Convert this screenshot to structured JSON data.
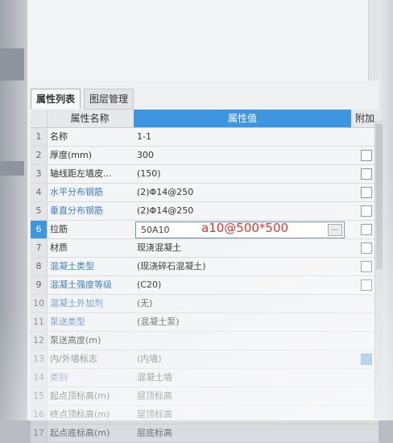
{
  "tabs": [
    {
      "label": "属性列表"
    },
    {
      "label": "图层管理"
    }
  ],
  "headers": {
    "name": "属性名称",
    "value": "属性值",
    "addon": "附加"
  },
  "rows": [
    {
      "num": "1",
      "name": "名称",
      "value": "1-1",
      "checkbox": false
    },
    {
      "num": "2",
      "name": "厚度(mm)",
      "value": "300",
      "checkbox": true
    },
    {
      "num": "3",
      "name": "轴线距左墙皮...",
      "value": "(150)",
      "checkbox": true
    },
    {
      "num": "4",
      "name": "水平分布钢筋",
      "value": "(2)Φ14@250",
      "checkbox": true
    },
    {
      "num": "5",
      "name": "垂直分布钢筋",
      "value": "(2)Φ14@250",
      "checkbox": true
    },
    {
      "num": "6",
      "name": "拉筋",
      "value": "50A10",
      "checkbox": true
    },
    {
      "num": "7",
      "name": "材质",
      "value": "现浇混凝土",
      "checkbox": true
    },
    {
      "num": "8",
      "name": "混凝土类型",
      "value": "(现浇碎石混凝土)",
      "checkbox": true
    },
    {
      "num": "9",
      "name": "混凝土强度等级",
      "value": "(C20)",
      "checkbox": true
    },
    {
      "num": "10",
      "name": "混凝土外加剂",
      "value": "(无)",
      "checkbox": false
    },
    {
      "num": "11",
      "name": "泵送类型",
      "value": "(混凝土泵)",
      "checkbox": false
    },
    {
      "num": "12",
      "name": "泵送高度(m)",
      "value": "",
      "checkbox": false
    },
    {
      "num": "13",
      "name": "内/外墙标志",
      "value": "(内墙)",
      "checkbox": true
    },
    {
      "num": "14",
      "name": "类别",
      "value": "混凝土墙",
      "checkbox": false
    },
    {
      "num": "15",
      "name": "起点顶标高(m)",
      "value": "层顶标高",
      "checkbox": false
    },
    {
      "num": "16",
      "name": "终点顶标高(m)",
      "value": "层顶标高",
      "checkbox": false
    },
    {
      "num": "17",
      "name": "起点底标高(m)",
      "value": "层底标高",
      "checkbox": false
    }
  ],
  "annotation": "a10@500*500",
  "edit_button": "..."
}
